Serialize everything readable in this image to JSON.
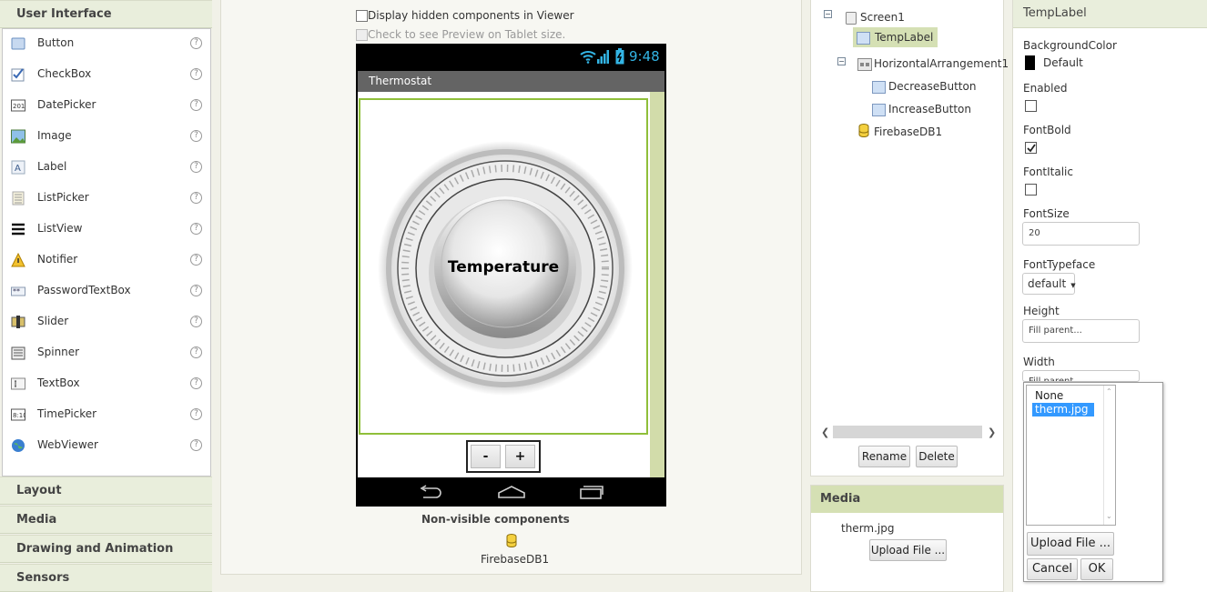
{
  "palette": {
    "user_interface": "User Interface",
    "items": [
      {
        "label": "Button",
        "icon": "button-icon"
      },
      {
        "label": "CheckBox",
        "icon": "checkbox-icon"
      },
      {
        "label": "DatePicker",
        "icon": "datepicker-icon"
      },
      {
        "label": "Image",
        "icon": "image-icon"
      },
      {
        "label": "Label",
        "icon": "label-icon"
      },
      {
        "label": "ListPicker",
        "icon": "listpicker-icon"
      },
      {
        "label": "ListView",
        "icon": "listview-icon"
      },
      {
        "label": "Notifier",
        "icon": "notifier-icon"
      },
      {
        "label": "PasswordTextBox",
        "icon": "passwordtextbox-icon"
      },
      {
        "label": "Slider",
        "icon": "slider-icon"
      },
      {
        "label": "Spinner",
        "icon": "spinner-icon"
      },
      {
        "label": "TextBox",
        "icon": "textbox-icon"
      },
      {
        "label": "TimePicker",
        "icon": "timepicker-icon"
      },
      {
        "label": "WebViewer",
        "icon": "webviewer-icon"
      }
    ],
    "help_glyph": "?",
    "sections": [
      "Layout",
      "Media",
      "Drawing and Animation",
      "Sensors"
    ]
  },
  "viewer": {
    "display_hidden_label": "Display hidden components in Viewer",
    "tablet_preview_label": "Check to see Preview on Tablet size.",
    "status_time": "9:48",
    "app_title": "Thermostat",
    "dial_text": "Temperature",
    "decrease_label": "-",
    "increase_label": "+",
    "nonvisible_title": "Non-visible components",
    "nonvisible_item": "FirebaseDB1"
  },
  "tree": {
    "screen": "Screen1",
    "templabel": "TempLabel",
    "harrangement": "HorizontalArrangement1",
    "decrease": "DecreaseButton",
    "increase": "IncreaseButton",
    "firebase": "FirebaseDB1",
    "toggle_glyph": "−",
    "rename": "Rename",
    "delete": "Delete"
  },
  "media": {
    "title": "Media",
    "file": "therm.jpg",
    "upload": "Upload File ..."
  },
  "properties": {
    "title": "TempLabel",
    "bgcolor_label": "BackgroundColor",
    "bgcolor_value": "Default",
    "enabled_label": "Enabled",
    "fontbold_label": "FontBold",
    "fontitalic_label": "FontItalic",
    "fontsize_label": "FontSize",
    "fontsize_value": "20",
    "typeface_label": "FontTypeface",
    "typeface_value": "default",
    "height_label": "Height",
    "height_value": "Fill parent...",
    "width_label": "Width",
    "width_value": "Fill parent..."
  },
  "popup": {
    "options": [
      "None",
      "therm.jpg"
    ],
    "selected": "therm.jpg",
    "upload": "Upload File ...",
    "cancel": "Cancel",
    "ok": "OK"
  },
  "colors": {
    "accent_green": "#8fbf3a",
    "selected_blue": "#3399ff",
    "header_green": "#d5e0b4"
  }
}
